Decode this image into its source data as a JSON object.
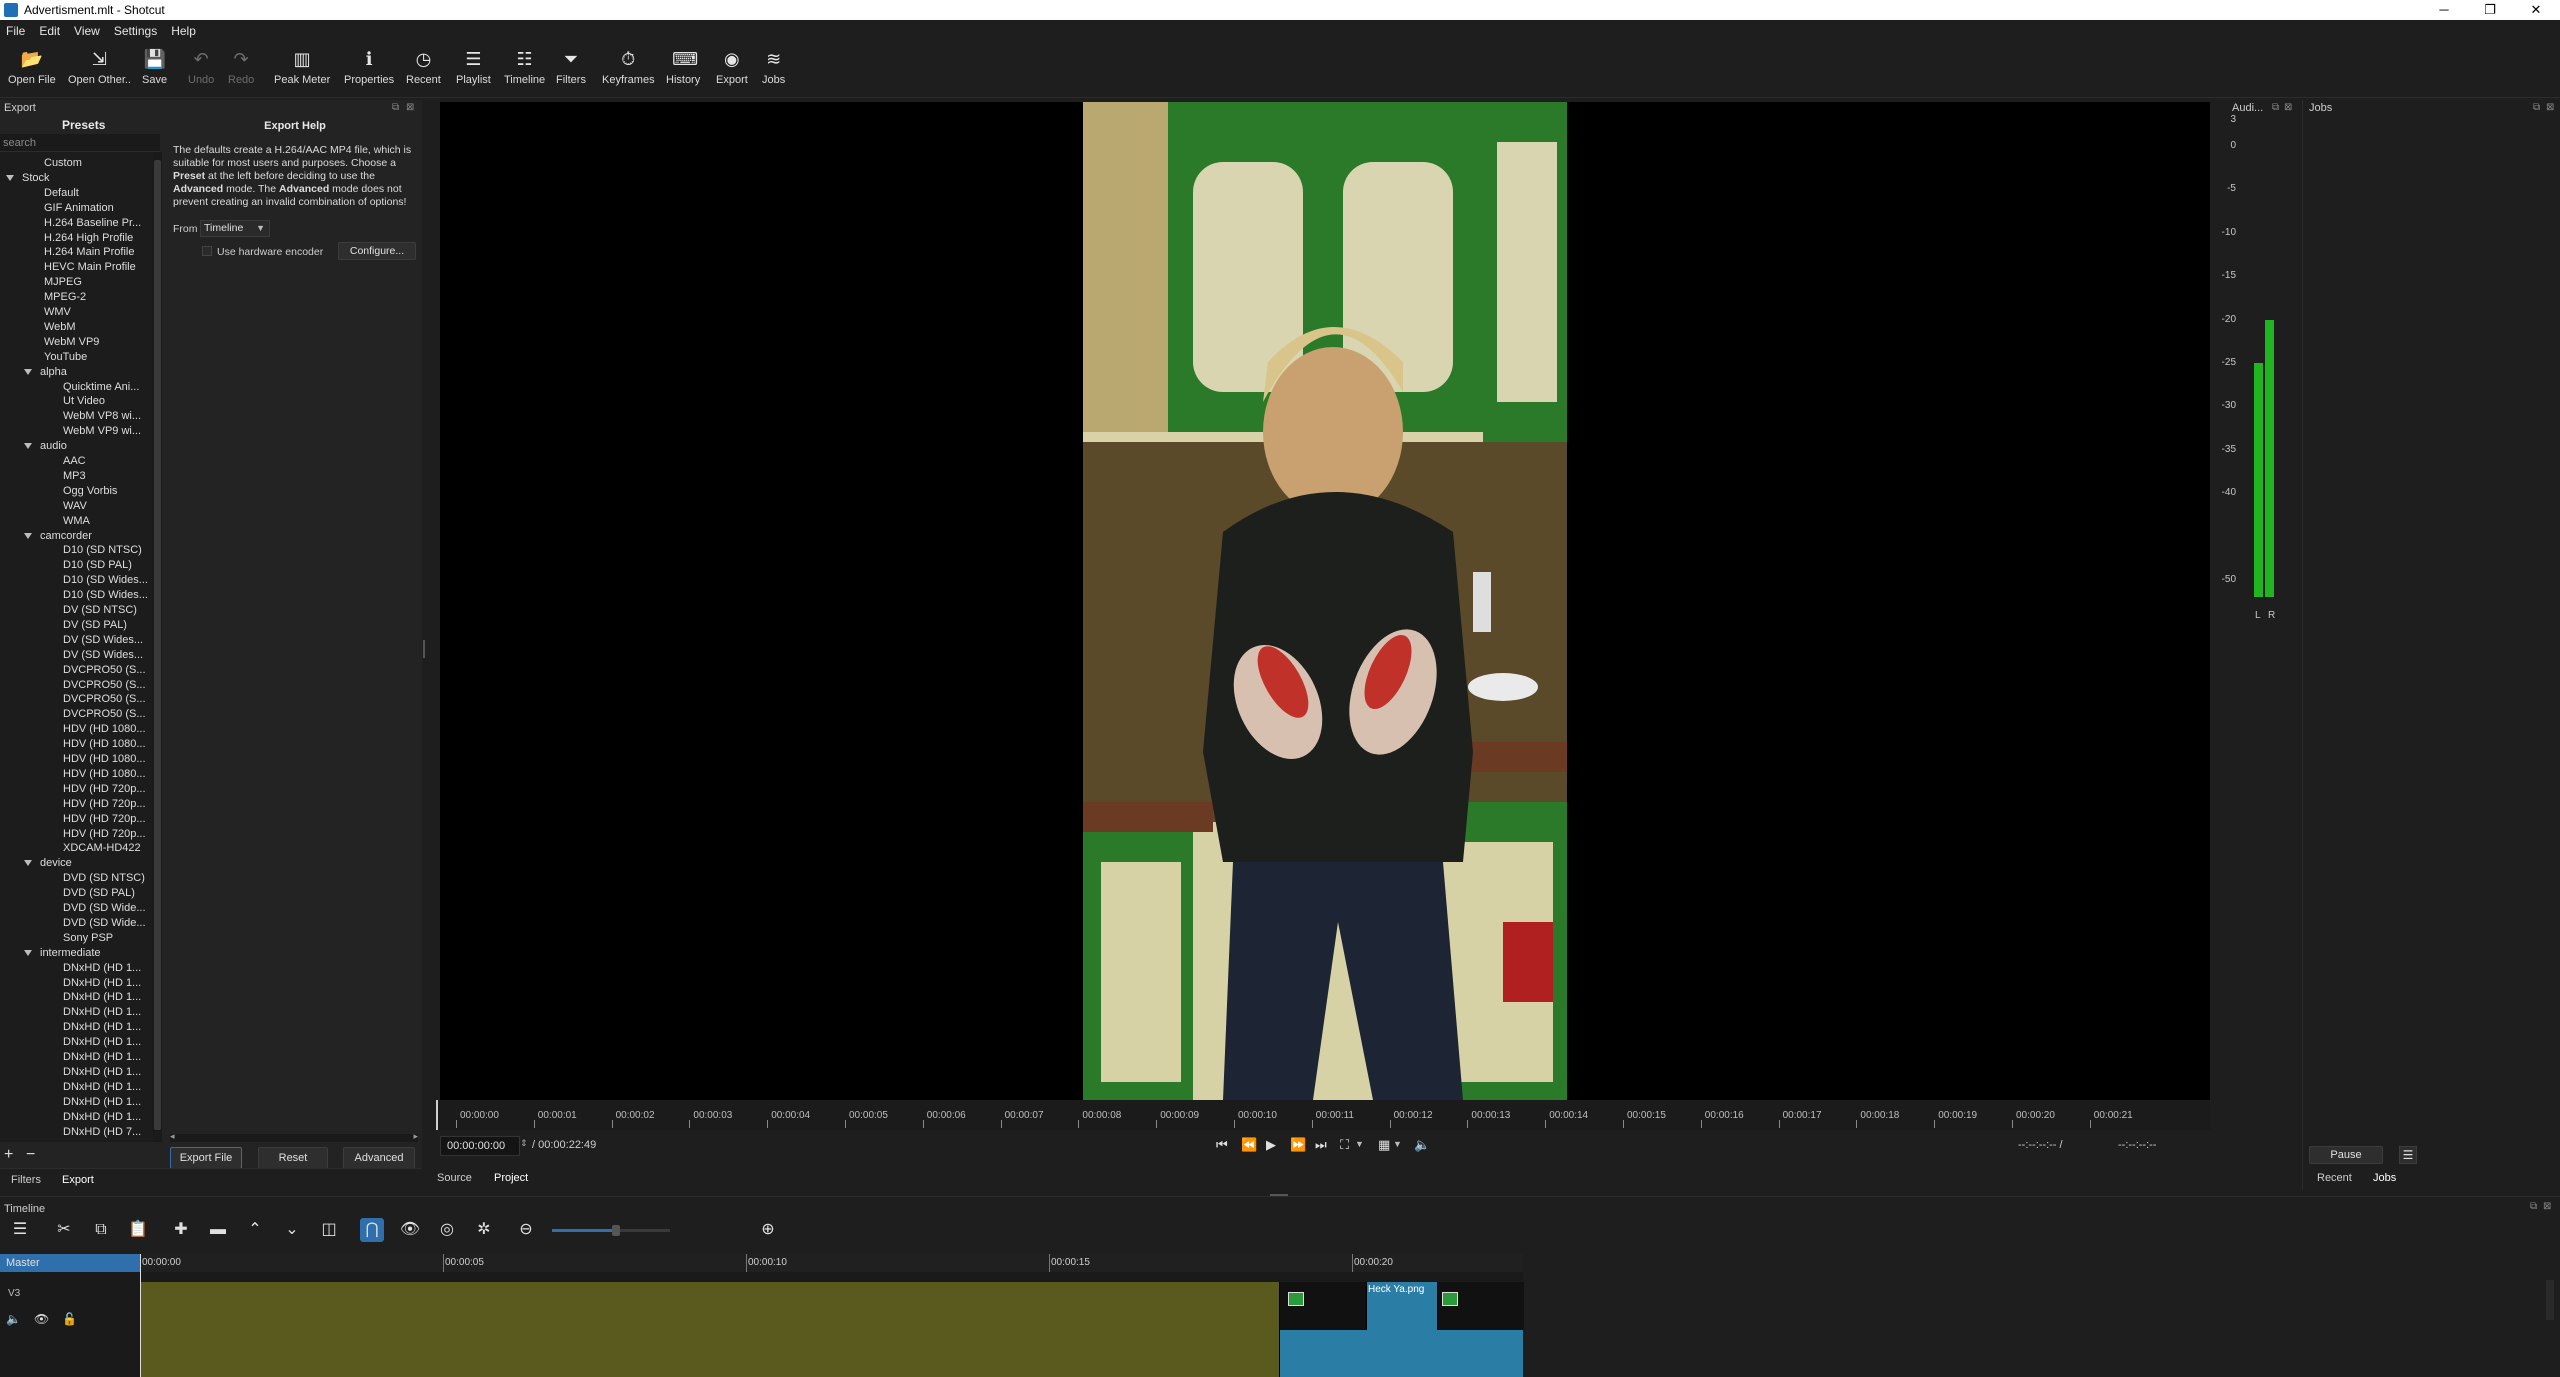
{
  "window": {
    "title": "Advertisment.mlt - Shotcut",
    "controls": [
      "minimize",
      "maximize",
      "close"
    ]
  },
  "menu": [
    "File",
    "Edit",
    "View",
    "Settings",
    "Help"
  ],
  "toolbar": [
    {
      "label": "Open File",
      "icon": "folder-open-icon",
      "glyph": "📂",
      "enabled": true
    },
    {
      "label": "Open Other..",
      "icon": "open-other-icon",
      "glyph": "⇲",
      "enabled": true
    },
    {
      "label": "Save",
      "icon": "save-icon",
      "glyph": "💾",
      "enabled": true
    },
    {
      "label": "Undo",
      "icon": "undo-icon",
      "glyph": "↶",
      "enabled": false
    },
    {
      "label": "Redo",
      "icon": "redo-icon",
      "glyph": "↷",
      "enabled": false
    },
    {
      "label": "Peak Meter",
      "icon": "peak-meter-icon",
      "glyph": "▥",
      "enabled": true
    },
    {
      "label": "Properties",
      "icon": "info-icon",
      "glyph": "ℹ",
      "enabled": true
    },
    {
      "label": "Recent",
      "icon": "clock-icon",
      "glyph": "◷",
      "enabled": true
    },
    {
      "label": "Playlist",
      "icon": "playlist-icon",
      "glyph": "☰",
      "enabled": true
    },
    {
      "label": "Timeline",
      "icon": "timeline-icon",
      "glyph": "☷",
      "enabled": true
    },
    {
      "label": "Filters",
      "icon": "funnel-icon",
      "glyph": "⏷",
      "enabled": true
    },
    {
      "label": "Keyframes",
      "icon": "stopwatch-icon",
      "glyph": "⏱",
      "enabled": true
    },
    {
      "label": "History",
      "icon": "history-icon",
      "glyph": "⌨",
      "enabled": true
    },
    {
      "label": "Export",
      "icon": "export-icon",
      "glyph": "◉",
      "enabled": true
    },
    {
      "label": "Jobs",
      "icon": "jobs-icon",
      "glyph": "≋",
      "enabled": true
    }
  ],
  "export_panel": {
    "dock_title": "Export",
    "presets_heading": "Presets",
    "search_placeholder": "search",
    "presets": [
      {
        "label": "Custom",
        "level": 1
      },
      {
        "label": "Stock",
        "level": 0,
        "group": true
      },
      {
        "label": "Default",
        "level": 1
      },
      {
        "label": "GIF Animation",
        "level": 1
      },
      {
        "label": "H.264 Baseline Pr...",
        "level": 1
      },
      {
        "label": "H.264 High Profile",
        "level": 1
      },
      {
        "label": "H.264 Main Profile",
        "level": 1
      },
      {
        "label": "HEVC Main Profile",
        "level": 1
      },
      {
        "label": "MJPEG",
        "level": 1
      },
      {
        "label": "MPEG-2",
        "level": 1
      },
      {
        "label": "WMV",
        "level": 1
      },
      {
        "label": "WebM",
        "level": 1
      },
      {
        "label": "WebM VP9",
        "level": 1
      },
      {
        "label": "YouTube",
        "level": 1
      },
      {
        "label": "alpha",
        "level": 1,
        "group": true
      },
      {
        "label": "Quicktime Ani...",
        "level": 2
      },
      {
        "label": "Ut Video",
        "level": 2
      },
      {
        "label": "WebM VP8 wi...",
        "level": 2
      },
      {
        "label": "WebM VP9 wi...",
        "level": 2
      },
      {
        "label": "audio",
        "level": 1,
        "group": true
      },
      {
        "label": "AAC",
        "level": 2
      },
      {
        "label": "MP3",
        "level": 2
      },
      {
        "label": "Ogg Vorbis",
        "level": 2
      },
      {
        "label": "WAV",
        "level": 2
      },
      {
        "label": "WMA",
        "level": 2
      },
      {
        "label": "camcorder",
        "level": 1,
        "group": true
      },
      {
        "label": "D10 (SD NTSC)",
        "level": 2
      },
      {
        "label": "D10 (SD PAL)",
        "level": 2
      },
      {
        "label": "D10 (SD Wides...",
        "level": 2
      },
      {
        "label": "D10 (SD Wides...",
        "level": 2
      },
      {
        "label": "DV (SD NTSC)",
        "level": 2
      },
      {
        "label": "DV (SD PAL)",
        "level": 2
      },
      {
        "label": "DV (SD Wides...",
        "level": 2
      },
      {
        "label": "DV (SD Wides...",
        "level": 2
      },
      {
        "label": "DVCPRO50 (S...",
        "level": 2
      },
      {
        "label": "DVCPRO50 (S...",
        "level": 2
      },
      {
        "label": "DVCPRO50 (S...",
        "level": 2
      },
      {
        "label": "DVCPRO50 (S...",
        "level": 2
      },
      {
        "label": "HDV (HD 1080...",
        "level": 2
      },
      {
        "label": "HDV (HD 1080...",
        "level": 2
      },
      {
        "label": "HDV (HD 1080...",
        "level": 2
      },
      {
        "label": "HDV (HD 1080...",
        "level": 2
      },
      {
        "label": "HDV (HD 720p...",
        "level": 2
      },
      {
        "label": "HDV (HD 720p...",
        "level": 2
      },
      {
        "label": "HDV (HD 720p...",
        "level": 2
      },
      {
        "label": "HDV (HD 720p...",
        "level": 2
      },
      {
        "label": "XDCAM-HD422",
        "level": 2
      },
      {
        "label": "device",
        "level": 1,
        "group": true
      },
      {
        "label": "DVD (SD NTSC)",
        "level": 2
      },
      {
        "label": "DVD (SD PAL)",
        "level": 2
      },
      {
        "label": "DVD (SD Wide...",
        "level": 2
      },
      {
        "label": "DVD (SD Wide...",
        "level": 2
      },
      {
        "label": "Sony PSP",
        "level": 2
      },
      {
        "label": "intermediate",
        "level": 1,
        "group": true
      },
      {
        "label": "DNxHD (HD 1...",
        "level": 2
      },
      {
        "label": "DNxHD (HD 1...",
        "level": 2
      },
      {
        "label": "DNxHD (HD 1...",
        "level": 2
      },
      {
        "label": "DNxHD (HD 1...",
        "level": 2
      },
      {
        "label": "DNxHD (HD 1...",
        "level": 2
      },
      {
        "label": "DNxHD (HD 1...",
        "level": 2
      },
      {
        "label": "DNxHD (HD 1...",
        "level": 2
      },
      {
        "label": "DNxHD (HD 1...",
        "level": 2
      },
      {
        "label": "DNxHD (HD 1...",
        "level": 2
      },
      {
        "label": "DNxHD (HD 1...",
        "level": 2
      },
      {
        "label": "DNxHD (HD 1...",
        "level": 2
      },
      {
        "label": "DNxHD (HD 7...",
        "level": 2
      }
    ],
    "help_title": "Export Help",
    "help_text_1": "The defaults create a H.264/AAC MP4 file, which is suitable for most users and purposes. Choose a",
    "help_bold_1": "Preset",
    "help_text_2": "at the left before deciding to use the",
    "help_bold_2": "Advanced",
    "help_text_3": "mode. The",
    "help_bold_3": "Advanced",
    "help_text_4": "mode does not prevent creating an invalid combination of options!",
    "from_label": "From",
    "from_value": "Timeline",
    "hw_encoder_label": "Use hardware encoder",
    "configure_label": "Configure...",
    "export_file_label": "Export File",
    "reset_label": "Reset",
    "advanced_label": "Advanced",
    "bottom_tabs": [
      "Filters",
      "Export"
    ]
  },
  "viewer": {
    "ruler_ticks": [
      "00:00:00",
      "00:00:01",
      "00:00:02",
      "00:00:03",
      "00:00:04",
      "00:00:05",
      "00:00:06",
      "00:00:07",
      "00:00:08",
      "00:00:09",
      "00:00:10",
      "00:00:11",
      "00:00:12",
      "00:00:13",
      "00:00:14",
      "00:00:15",
      "00:00:16",
      "00:00:17",
      "00:00:18",
      "00:00:19",
      "00:00:20",
      "00:00:21"
    ],
    "current_time": "00:00:00:00",
    "total_time": "/ 00:00:22:49",
    "in_point": "--:--:--:-- /",
    "out_point": "--:--:--:--",
    "tabs": [
      "Source",
      "Project"
    ],
    "playhead_fraction": 0.0
  },
  "audio_meter": {
    "title": "Audi...",
    "scale": [
      "3",
      "0",
      "-5",
      "-10",
      "-15",
      "-20",
      "-25",
      "-30",
      "-35",
      "-40",
      "-50"
    ],
    "channels": [
      "L",
      "R"
    ],
    "levels_db": [
      -25,
      -20
    ],
    "color": "#22b522"
  },
  "jobs": {
    "title": "Jobs",
    "pause_label": "Pause",
    "tabs": [
      "Recent",
      "Jobs"
    ]
  },
  "timeline": {
    "dock_title": "Timeline",
    "track_master": "Master",
    "track_name": "V3",
    "ruler_ticks": [
      "00:00:00",
      "00:00:05",
      "00:00:10",
      "00:00:15",
      "00:00:20"
    ],
    "clip_label": "Heck Ya.png",
    "colors": {
      "track_fill": "#5a5a1f",
      "clip_fill": "#2a7ea6",
      "master_bg": "#2f6fab"
    }
  },
  "colors": {
    "accent": "#2f6fab",
    "meter_green": "#22b522"
  }
}
